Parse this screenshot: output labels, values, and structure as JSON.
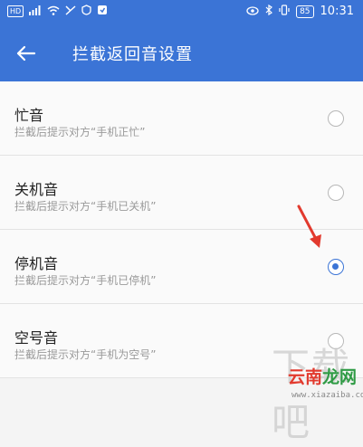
{
  "status_bar": {
    "left_indicators": [
      "HD",
      "4G",
      "wifi",
      "notification",
      "shield"
    ],
    "time": "10:31",
    "battery": "85"
  },
  "app_bar": {
    "title": "拦截返回音设置",
    "back_icon": "arrow-left-icon",
    "background_color": "#3b74d6"
  },
  "options": [
    {
      "label": "忙音",
      "description": "拦截后提示对方“手机正忙”",
      "selected": false
    },
    {
      "label": "关机音",
      "description": "拦截后提示对方“手机已关机”",
      "selected": false
    },
    {
      "label": "停机音",
      "description": "拦截后提示对方“手机已停机”",
      "selected": true
    },
    {
      "label": "空号音",
      "description": "拦截后提示对方“手机为空号”",
      "selected": false
    }
  ],
  "watermark": {
    "logo_left": "云南",
    "logo_right": "龙网",
    "url": "www.xiazaiba.com",
    "glyphs": "下载吧"
  }
}
